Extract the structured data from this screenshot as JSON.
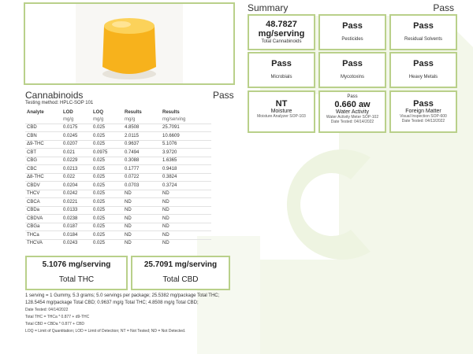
{
  "summary": {
    "title": "Summary",
    "status": "Pass",
    "tiles": [
      {
        "main": "48.7827 mg/serving",
        "sub": "Total Cannabinoids"
      },
      {
        "main": "Pass",
        "sub": "Pesticides"
      },
      {
        "main": "Pass",
        "sub": "Residual Solvents"
      },
      {
        "main": "Pass",
        "sub": "Microbials"
      },
      {
        "main": "Pass",
        "sub": "Mycotoxins"
      },
      {
        "main": "Pass",
        "sub": "Heavy Metals"
      }
    ],
    "tiles_bottom": [
      {
        "top": "",
        "main": "NT",
        "label": "Moisture",
        "method": "Moisture Analyzer SOP-103",
        "date": ""
      },
      {
        "top": "Pass",
        "main": "0.660 aw",
        "label": "Water Activity",
        "method": "Water Activity Meter SOP-102",
        "date": "Date Tested: 04/14/2022"
      },
      {
        "top": "",
        "main": "Pass",
        "label": "Foreign Matter",
        "method": "Visual Inspection SOP-600",
        "date": "Date Tested: 04/13/2022"
      }
    ]
  },
  "cannabinoids": {
    "title": "Cannabinoids",
    "status": "Pass",
    "method": "Testing method: HPLC-SOP 101",
    "headers": [
      "Analyte",
      "LOD",
      "LOQ",
      "Results",
      "Results"
    ],
    "units": [
      "",
      "mg/g",
      "mg/g",
      "mg/g",
      "mg/serving"
    ],
    "rows": [
      [
        "CBD",
        "0.0175",
        "0.025",
        "4.8508",
        "25.7091"
      ],
      [
        "CBN",
        "0.0245",
        "0.025",
        "2.0115",
        "10.6609"
      ],
      [
        "Δ9-THC",
        "0.0207",
        "0.025",
        "0.9637",
        "5.1076"
      ],
      [
        "CBT",
        "0.021",
        "0.0975",
        "0.7494",
        "3.9720"
      ],
      [
        "CBG",
        "0.0229",
        "0.025",
        "0.3088",
        "1.6365"
      ],
      [
        "CBC",
        "0.0213",
        "0.025",
        "0.1777",
        "0.9418"
      ],
      [
        "Δ8-THC",
        "0.022",
        "0.025",
        "0.0722",
        "0.3824"
      ],
      [
        "CBDV",
        "0.0204",
        "0.025",
        "0.0703",
        "0.3724"
      ],
      [
        "THCV",
        "0.0242",
        "0.025",
        "ND",
        "ND"
      ],
      [
        "CBCA",
        "0.0221",
        "0.025",
        "ND",
        "ND"
      ],
      [
        "CBDa",
        "0.0133",
        "0.025",
        "ND",
        "ND"
      ],
      [
        "CBDVA",
        "0.0238",
        "0.025",
        "ND",
        "ND"
      ],
      [
        "CBGa",
        "0.0187",
        "0.025",
        "ND",
        "ND"
      ],
      [
        "THCa",
        "0.0184",
        "0.025",
        "ND",
        "ND"
      ],
      [
        "THCVA",
        "0.0243",
        "0.025",
        "ND",
        "ND"
      ]
    ]
  },
  "totals": {
    "thc_value": "5.1076 mg/serving",
    "thc_label": "Total THC",
    "cbd_value": "25.7091 mg/serving",
    "cbd_label": "Total CBD"
  },
  "notes": {
    "line1": "1 serving = 1 Gummy, 5.3 grams; 5.0 servings per package; 25.5382 mg/package Total THC; 128.5454 mg/package Total CBD; 0.9637 mg/g Total THC; 4.8508 mg/g Total CBD;",
    "date": "Date Tested: 04/14/2022",
    "thc_formula": "Total THC = THCa * 0.877 + d9-THC",
    "cbd_formula": "Total CBD = CBDa * 0.877 + CBD",
    "legend": "LOQ = Limit of Quantitation; LOD = Limit of Detection; NT = Not Tested; ND = Not Detected."
  },
  "colors": {
    "accent": "#b9d08a",
    "gummy": "#f7b21c"
  }
}
